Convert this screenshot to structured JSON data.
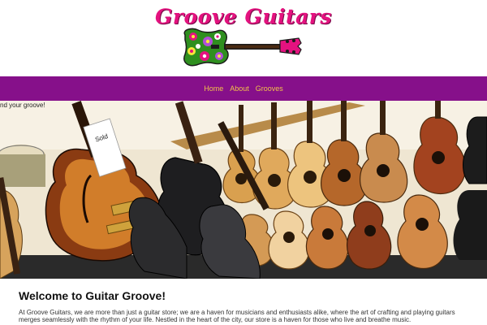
{
  "brand": {
    "name": "Groove Guitars"
  },
  "nav": {
    "items": [
      {
        "label": "Home"
      },
      {
        "label": "About"
      },
      {
        "label": "Grooves"
      }
    ]
  },
  "hero": {
    "caption": "nd your groove!",
    "sign_text": "Sold"
  },
  "main": {
    "title": "Welcome to Guitar Groove!",
    "intro": "At Groove Guitars, we are more than just a guitar store; we are a haven for musicians and enthusiasts alike, where the art of crafting and playing guitars merges seamlessly with the rhythm of your life. Nestled in the heart of the city, our store is a haven for those who live and breathe music."
  },
  "colors": {
    "nav_bg": "#86108a",
    "nav_link": "#f2c24a",
    "logo_pink": "#e4127f",
    "logo_green": "#2f8f1f"
  },
  "icons": {
    "logo": "flower-guitar-icon"
  }
}
